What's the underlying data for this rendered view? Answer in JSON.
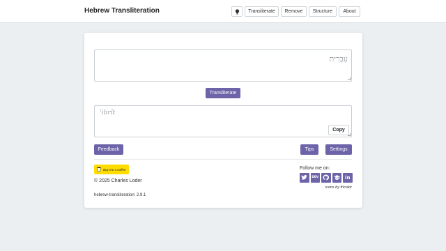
{
  "header": {
    "title": "Hebrew Transliteration",
    "nav": {
      "theme_icon": "lightbulb-icon",
      "transliterate": "Transliterate",
      "remove": "Remove",
      "structure": "Structure",
      "about": "About"
    }
  },
  "main": {
    "input": {
      "placeholder": "עִבְרִית"
    },
    "transliterate_button": "Transliterate",
    "output": {
      "placeholder": "ʿibrît"
    },
    "copy_button": "Copy",
    "feedback_button": "Feedback",
    "tips_button": "Tips",
    "settings_button": "Settings"
  },
  "footer": {
    "coffee_label": "Buy me a coffee",
    "copyright": "© 2025 Charles Loder",
    "version": "hebrew-transliteration: 2.9.1",
    "follow_label": "Follow me on:",
    "socials": [
      "twitter-icon",
      "dev-icon",
      "github-icon",
      "graduation-cap-icon",
      "linkedin-icon"
    ],
    "dev_text": "DEV",
    "linkedin_text": "in",
    "icons_credit": "icons by fricolor"
  },
  "colors": {
    "accent": "#6c63a8",
    "coffee": "#ffdd00",
    "background": "#eceff1"
  }
}
